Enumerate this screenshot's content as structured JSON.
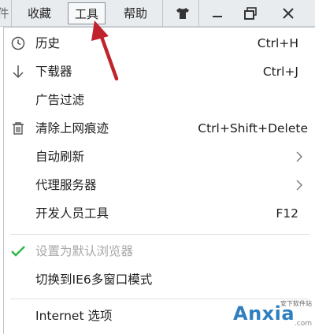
{
  "menubar": {
    "partial": "件",
    "collect": "收藏",
    "tools": "工具",
    "help": "帮助"
  },
  "icons": {
    "skin": "shirt-icon",
    "minimize": "minimize-icon",
    "restore": "restore-icon",
    "close": "close-icon"
  },
  "menu": {
    "history": {
      "label": "历史",
      "shortcut": "Ctrl+H"
    },
    "downloads": {
      "label": "下载器",
      "shortcut": "Ctrl+J"
    },
    "adfilter": {
      "label": "广告过滤"
    },
    "clear": {
      "label": "清除上网痕迹",
      "shortcut": "Ctrl+Shift+Delete"
    },
    "autorefresh": {
      "label": "自动刷新"
    },
    "proxy": {
      "label": "代理服务器"
    },
    "devtools": {
      "label": "开发人员工具",
      "shortcut": "F12"
    },
    "defaultbrowser": {
      "label": "设置为默认浏览器"
    },
    "ie6mode": {
      "label": "切换到IE6多窗口模式"
    },
    "internetoptions": {
      "label": "Internet 选项"
    }
  },
  "watermark": {
    "brand": "Anxia",
    "tagline": "安下软件站",
    "domain": ".com"
  },
  "colors": {
    "arrow": "#c0232b",
    "check": "#2db84a",
    "brand": "#2f7fbf"
  }
}
